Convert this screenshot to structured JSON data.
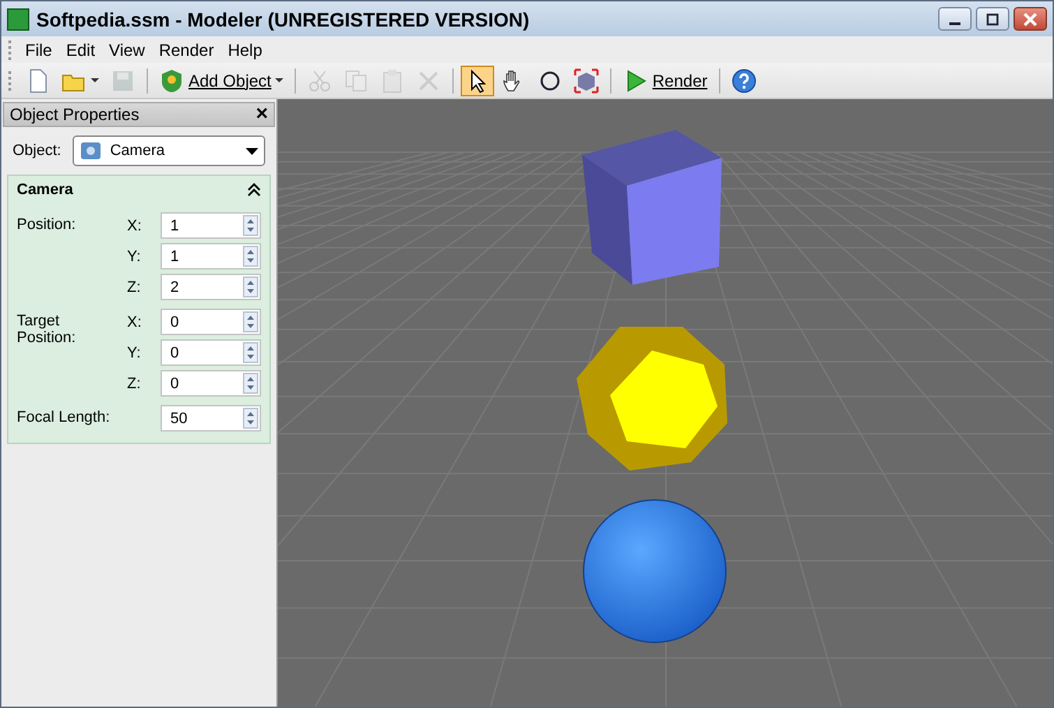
{
  "window": {
    "title": "Softpedia.ssm - Modeler (UNREGISTERED VERSION)"
  },
  "menu": [
    "File",
    "Edit",
    "View",
    "Render",
    "Help"
  ],
  "toolbar": [
    {
      "kind": "icon",
      "disabled": false,
      "selected": false
    },
    {
      "kind": "icon-dropdown",
      "disabled": false,
      "selected": false
    },
    {
      "kind": "icon",
      "disabled": true,
      "selected": false
    },
    {
      "kind": "separator"
    },
    {
      "kind": "labeled-dropdown",
      "label": "Add Object",
      "disabled": false,
      "selected": false
    },
    {
      "kind": "separator"
    },
    {
      "kind": "icon",
      "disabled": true,
      "selected": false
    },
    {
      "kind": "icon",
      "disabled": true,
      "selected": false
    },
    {
      "kind": "icon",
      "disabled": true,
      "selected": false
    },
    {
      "kind": "icon",
      "disabled": true,
      "selected": false
    },
    {
      "kind": "separator"
    },
    {
      "kind": "icon",
      "disabled": false,
      "selected": true
    },
    {
      "kind": "icon",
      "disabled": false,
      "selected": false
    },
    {
      "kind": "icon",
      "disabled": false,
      "selected": false
    },
    {
      "kind": "icon",
      "disabled": false,
      "selected": false
    },
    {
      "kind": "separator"
    },
    {
      "kind": "labeled",
      "label": "Render",
      "disabled": false,
      "selected": false
    },
    {
      "kind": "separator"
    },
    {
      "kind": "icon",
      "disabled": false,
      "selected": false
    }
  ],
  "properties": {
    "title": "Object Properties",
    "close": "×",
    "object_label": "Object:",
    "object_value": "Camera",
    "section": {
      "title": "Camera",
      "expanded": true,
      "groups": [
        {
          "label": "Position:",
          "fields": [
            {
              "axis": "X:",
              "value": "1"
            },
            {
              "axis": "Y:",
              "value": "1"
            },
            {
              "axis": "Z:",
              "value": "2"
            }
          ]
        },
        {
          "label": "Target Position:",
          "fields": [
            {
              "axis": "X:",
              "value": "0"
            },
            {
              "axis": "Y:",
              "value": "0"
            },
            {
              "axis": "Z:",
              "value": "0"
            }
          ]
        },
        {
          "label": "Focal Length:",
          "fields": [
            {
              "value": "50"
            }
          ]
        }
      ]
    }
  }
}
